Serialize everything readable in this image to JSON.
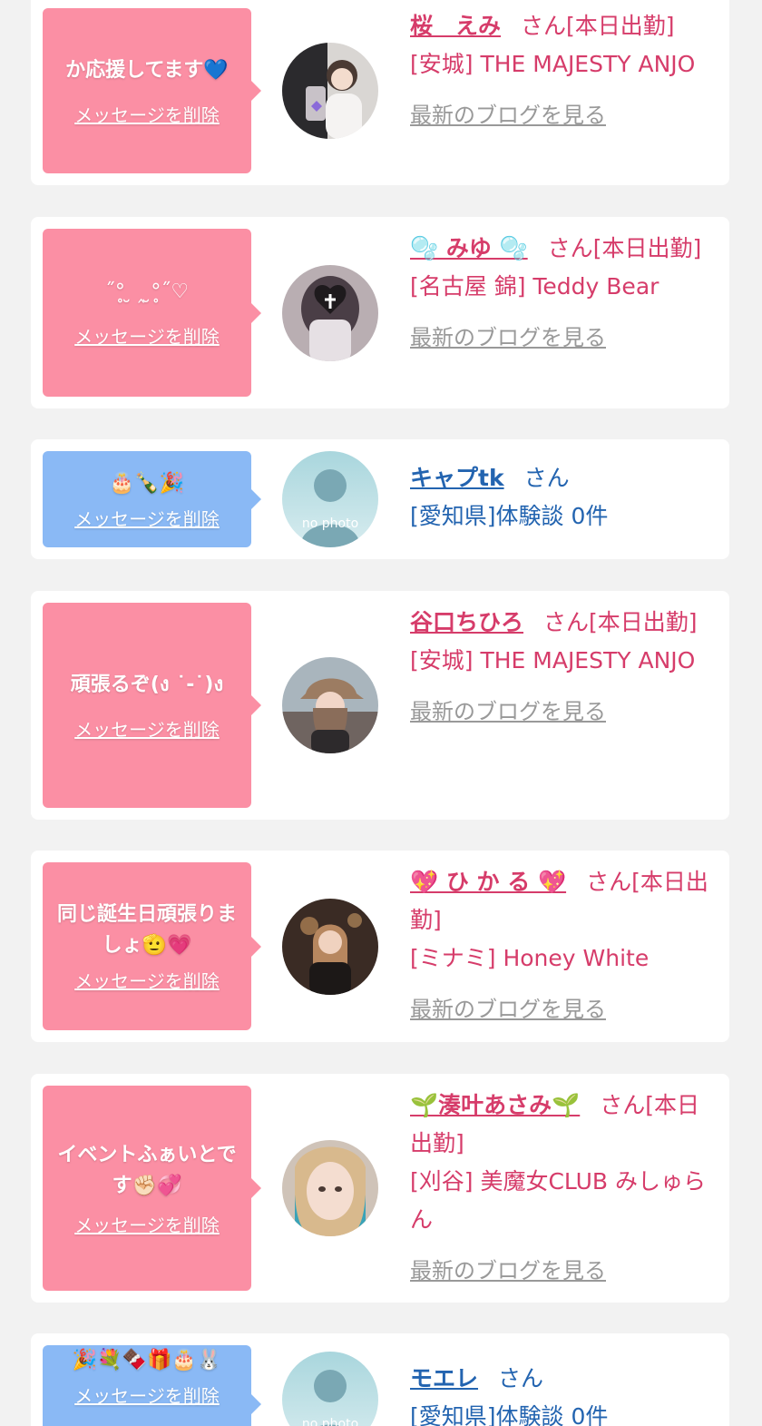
{
  "delete_label": "メッセージを削除",
  "blog_label": "最新のブログを見る",
  "san": "さん",
  "colors": {
    "page_bg": "#f2f2f2",
    "card_bg": "#ffffff",
    "bubble_pink": "#fb8fa4",
    "bubble_blue": "#8ab9f5",
    "cast_name": "#d63c6a",
    "user_name": "#2364b0",
    "blog_link": "#999999"
  },
  "cards": [
    {
      "message": "か応援してます💙",
      "name": "桜　えみ",
      "status": "[本日出勤]",
      "shop": "[安城] THE MAJESTY ANJO",
      "avatar": "cast-photo"
    },
    {
      "message": "˝°̥ ̮ ‸ ̮°̥˝♡",
      "name": "🫧 みゆ 🫧",
      "status": "[本日出勤]",
      "shop": "[名古屋 錦] Teddy Bear",
      "avatar": "cast-photo"
    },
    {
      "message": "🎂🍾🎉",
      "name": "キャプtk",
      "shop": "[愛知県]体験談 0件",
      "avatar": "no photo"
    },
    {
      "message": "頑張るぞ(ง ˙-˙)ง",
      "name": "谷口ちひろ",
      "status": "[本日出勤]",
      "shop": "[安城] THE MAJESTY ANJO",
      "avatar": "cast-photo"
    },
    {
      "message": "同じ誕生日頑張りましょ🫡💗",
      "name": "💖 ひ か る 💖",
      "status": "[本日出勤]",
      "shop": "[ミナミ] Honey White",
      "avatar": "cast-photo"
    },
    {
      "message": "イベントふぁいとです✊🏻💞",
      "name": "🌱湊叶あさみ🌱",
      "status": "[本日出勤]",
      "shop": "[刈谷] 美魔女CLUB みしゅらん",
      "avatar": "cast-photo"
    },
    {
      "message": "🎉💐🍫🎁🎂🐰",
      "name": "モエレ",
      "shop": "[愛知県]体験談 0件",
      "avatar": "no photo"
    }
  ]
}
